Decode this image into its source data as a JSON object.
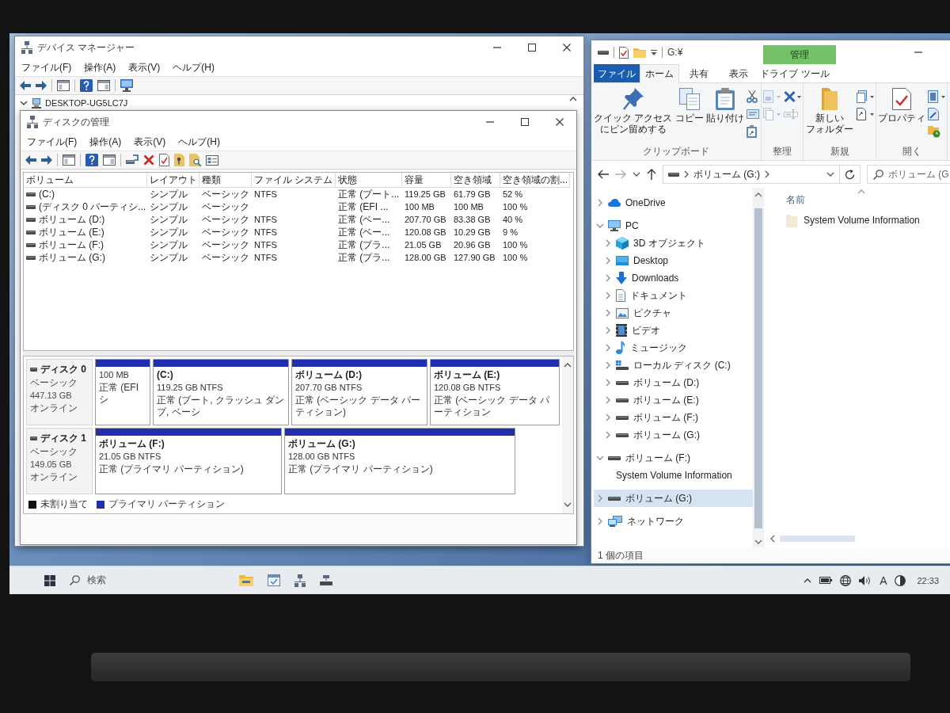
{
  "device_manager": {
    "title": "デバイス マネージャー",
    "menu": [
      "ファイル(F)",
      "操作(A)",
      "表示(V)",
      "ヘルプ(H)"
    ],
    "tree": [
      {
        "label": "DESKTOP-UG5LC7J",
        "expanded": true
      }
    ]
  },
  "disk_management": {
    "title": "ディスクの管理",
    "menu": [
      "ファイル(F)",
      "操作(A)",
      "表示(V)",
      "ヘルプ(H)"
    ],
    "table": {
      "columns": [
        "ボリューム",
        "レイアウト",
        "種類",
        "ファイル システム",
        "状態",
        "容量",
        "空き領域",
        "空き領域の割..."
      ],
      "rows": [
        {
          "volume": "(C:)",
          "layout": "シンプル",
          "type": "ベーシック",
          "file_system": "NTFS",
          "status": "正常 (ブート...",
          "capacity": "119.25 GB",
          "free": "61.79 GB",
          "free_percent": "52 %"
        },
        {
          "volume": "(ディスク 0 パーティシ...",
          "layout": "シンプル",
          "type": "ベーシック",
          "status": "正常 (EFI ...",
          "capacity": "100 MB",
          "free": "100 MB",
          "free_percent": "100 %"
        },
        {
          "volume": "ボリューム (D:)",
          "layout": "シンプル",
          "type": "ベーシック",
          "file_system": "NTFS",
          "status": "正常 (ベー...",
          "capacity": "207.70 GB",
          "free": "83.38 GB",
          "free_percent": "40 %"
        },
        {
          "volume": "ボリューム (E:)",
          "layout": "シンプル",
          "type": "ベーシック",
          "file_system": "NTFS",
          "status": "正常 (ベー...",
          "capacity": "120.08 GB",
          "free": "10.29 GB",
          "free_percent": "9 %"
        },
        {
          "volume": "ボリューム (F:)",
          "layout": "シンプル",
          "type": "ベーシック",
          "file_system": "NTFS",
          "status": "正常 (プラ...",
          "capacity": "21.05 GB",
          "free": "20.96 GB",
          "free_percent": "100 %"
        },
        {
          "volume": "ボリューム (G:)",
          "layout": "シンプル",
          "type": "ベーシック",
          "file_system": "NTFS",
          "status": "正常 (プラ...",
          "capacity": "128.00 GB",
          "free": "127.90 GB",
          "free_percent": "100 %"
        }
      ]
    },
    "disks": [
      {
        "name": "ディスク 0",
        "type": "ベーシック",
        "size": "447.13 GB",
        "status": "オンライン",
        "partitions": [
          {
            "kind": "primary",
            "size": "100 MB",
            "status": "正常 (EFI シ"
          },
          {
            "kind": "primary",
            "name": "(C:)",
            "size": "119.25 GB NTFS",
            "status": "正常 (ブート, クラッシュ ダンプ, ベーシ"
          },
          {
            "kind": "primary",
            "name": "ボリューム (D:)",
            "size": "207.70 GB NTFS",
            "status": "正常 (ベーシック データ パーティション)"
          },
          {
            "kind": "primary",
            "name": "ボリューム (E:)",
            "size": "120.08 GB NTFS",
            "status": "正常 (ベーシック データ パーティション"
          }
        ]
      },
      {
        "name": "ディスク 1",
        "type": "ベーシック",
        "size": "149.05 GB",
        "status": "オンライン",
        "partitions": [
          {
            "kind": "primary",
            "name": "ボリューム (F:)",
            "size": "21.05 GB NTFS",
            "status": "正常 (プライマリ パーティション)"
          },
          {
            "kind": "primary",
            "name": "ボリューム (G:)",
            "size": "128.00 GB NTFS",
            "status": "正常 (プライマリ パーティション)"
          }
        ]
      }
    ],
    "legend": [
      {
        "kind": "unallocated",
        "label": "未割り当て",
        "color": "#111111"
      },
      {
        "kind": "primary",
        "label": "プライマリ パーティション",
        "color": "#1f2fb0"
      }
    ]
  },
  "explorer": {
    "title": "G:¥",
    "context_header": "管理",
    "tabs": [
      {
        "label": "ファイル",
        "kind": "file",
        "selected": false
      },
      {
        "label": "ホーム",
        "kind": "tab",
        "selected": true
      },
      {
        "label": "共有",
        "kind": "tab",
        "selected": false
      },
      {
        "label": "表示",
        "kind": "tab",
        "selected": false
      },
      {
        "label": "ドライブ ツール",
        "kind": "context",
        "selected": false
      }
    ],
    "ribbon": [
      {
        "label": "クリップボード",
        "buttons": [
          {
            "kind": "pin",
            "label": "クイック アクセスにピン留めする"
          },
          {
            "kind": "copy",
            "label": "コピー"
          },
          {
            "kind": "paste",
            "label": "貼り付け"
          }
        ],
        "tools": [
          {
            "kind": "cut"
          },
          {
            "kind": "copy_path"
          },
          {
            "kind": "paste_shortcut"
          }
        ]
      },
      {
        "label": "整理",
        "tools": [
          {
            "kind": "move_to"
          },
          {
            "kind": "copy_to"
          },
          {
            "kind": "delete"
          },
          {
            "kind": "rename"
          }
        ]
      },
      {
        "label": "新規",
        "buttons": [
          {
            "kind": "new_folder",
            "label": "新しいフォルダー"
          }
        ],
        "tools": [
          {
            "kind": "new_item"
          },
          {
            "kind": "easy_access"
          }
        ]
      },
      {
        "label": "開く",
        "buttons": [
          {
            "kind": "properties",
            "label": "プロパティ"
          }
        ],
        "tools": [
          {
            "kind": "open"
          },
          {
            "kind": "edit"
          },
          {
            "kind": "history"
          }
        ]
      }
    ],
    "address": {
      "crumbs": [
        "ボリューム (G:)"
      ]
    },
    "search": {
      "placeholder": "ボリューム (G"
    },
    "nav": [
      {
        "label": "OneDrive",
        "kind": "cloud",
        "expanded": false,
        "selected": false
      },
      {
        "label": "PC",
        "kind": "computer",
        "expanded": true,
        "selected": false,
        "children": [
          {
            "label": "3D オブジェクト",
            "kind": "cube",
            "expanded": false,
            "selected": false
          },
          {
            "label": "Desktop",
            "kind": "desktop",
            "expanded": false,
            "selected": false
          },
          {
            "label": "Downloads",
            "kind": "download",
            "expanded": false,
            "selected": false
          },
          {
            "label": "ドキュメント",
            "kind": "document",
            "expanded": false,
            "selected": false
          },
          {
            "label": "ピクチャ",
            "kind": "picture",
            "expanded": false,
            "selected": false
          },
          {
            "label": "ビデオ",
            "kind": "video",
            "expanded": false,
            "selected": false
          },
          {
            "label": "ミュージック",
            "kind": "music",
            "expanded": false,
            "selected": false
          },
          {
            "label": "ローカル ディスク (C:)",
            "kind": "sysdrive",
            "expanded": false,
            "selected": false
          },
          {
            "label": "ボリューム (D:)",
            "kind": "drive",
            "expanded": false,
            "selected": false
          },
          {
            "label": "ボリューム (E:)",
            "kind": "drive",
            "expanded": false,
            "selected": false
          },
          {
            "label": "ボリューム (F:)",
            "kind": "drive",
            "expanded": false,
            "selected": false
          },
          {
            "label": "ボリューム (G:)",
            "kind": "drive",
            "expanded": false,
            "selected": false
          }
        ]
      },
      {
        "label": "ボリューム (F:)",
        "kind": "drive",
        "expanded": true,
        "selected": false,
        "children": [
          {
            "label": "System Volume Information",
            "selected": false
          }
        ]
      },
      {
        "label": "ボリューム (G:)",
        "kind": "drive",
        "expanded": false,
        "selected": true
      },
      {
        "label": "ネットワーク",
        "kind": "network",
        "expanded": false,
        "selected": false
      }
    ],
    "content": {
      "columns": [
        "名前"
      ],
      "items": [
        {
          "name": "System Volume Information"
        }
      ]
    },
    "status_bar": "1 個の項目"
  },
  "taskbar": {
    "search_label": "検索",
    "ime": "A",
    "clock": "22:33"
  }
}
